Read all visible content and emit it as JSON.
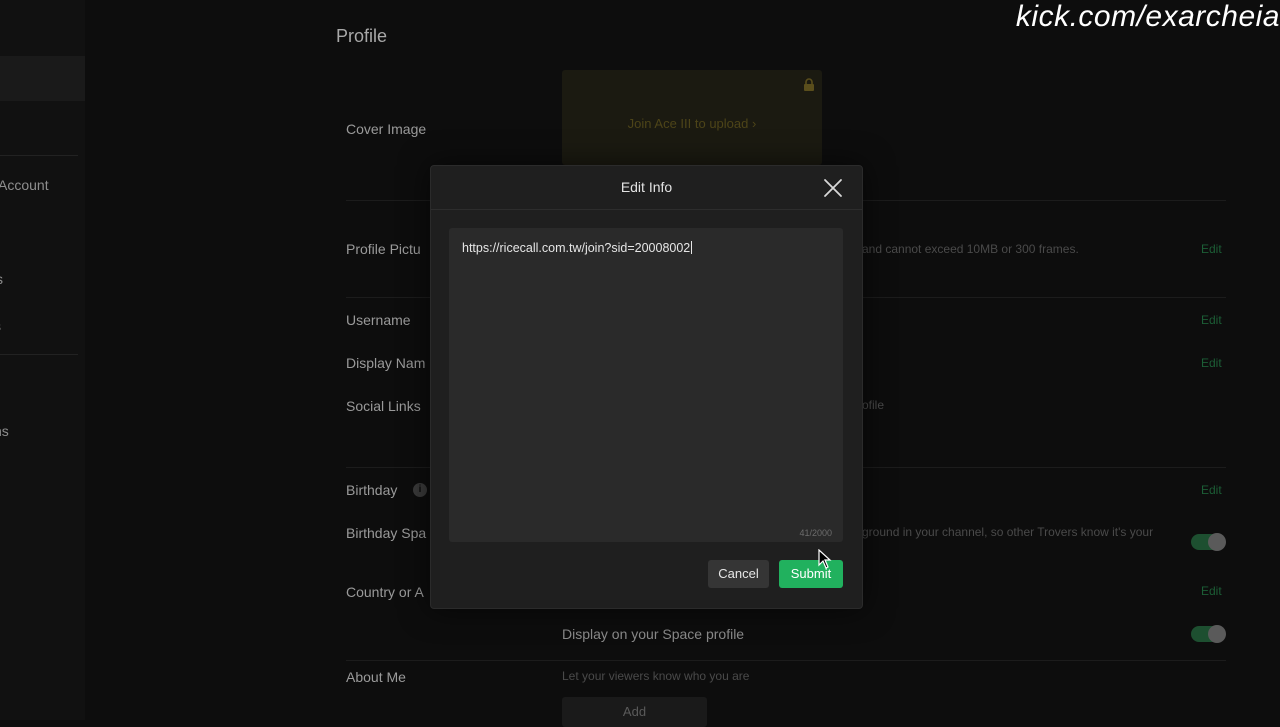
{
  "watermark": "kick.com/exarcheia",
  "sidebar": {
    "items": [
      {
        "label": "Account"
      },
      {
        "label": "s"
      },
      {
        "label": "s"
      },
      {
        "label": "ns"
      }
    ]
  },
  "page": {
    "title": "Profile",
    "cover_image": {
      "label": "Cover Image",
      "cta": "Join Ace III to upload",
      "cta_arrow": "›"
    },
    "profile_picture": {
      "label": "Profile Pictu",
      "hint": "and cannot exceed 10MB or 300 frames.",
      "edit": "Edit"
    },
    "username": {
      "label": "Username",
      "edit": "Edit"
    },
    "display_name": {
      "label": "Display Nam",
      "edit": "Edit"
    },
    "social_links": {
      "label": "Social Links",
      "hint": "ofile"
    },
    "birthday": {
      "label": "Birthday",
      "info": "i",
      "edit": "Edit"
    },
    "birthday_space": {
      "label": "Birthday Spa",
      "hint": "ground in your channel, so other Trovers know it's your"
    },
    "country": {
      "label": "Country or A",
      "edit": "Edit",
      "display_option": "Display on your Space profile"
    },
    "about_me": {
      "label": "About Me",
      "hint": "Let your viewers know who you are",
      "add": "Add"
    }
  },
  "modal": {
    "title": "Edit Info",
    "text_value": "https://ricecall.com.tw/join?sid=20008002",
    "counter": "41/2000",
    "cancel_label": "Cancel",
    "submit_label": "Submit"
  },
  "colors": {
    "accent": "#21b15e",
    "background": "#0d0d0d",
    "modal": "#1f1f1f"
  }
}
